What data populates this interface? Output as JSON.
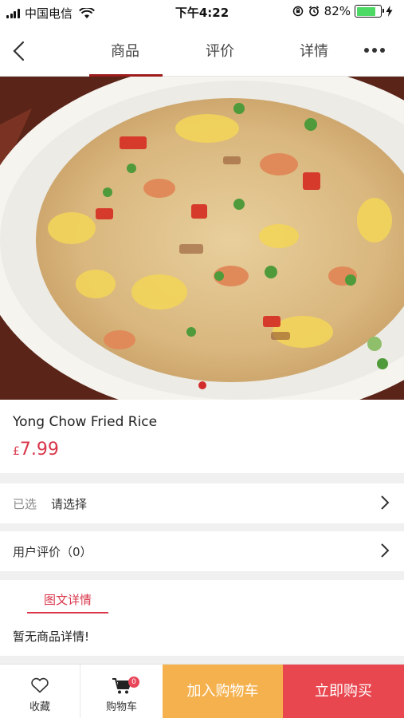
{
  "status_bar": {
    "carrier": "中国电信",
    "time": "下午4:22",
    "battery_percent": "82%",
    "battery_level": 0.82
  },
  "nav": {
    "tabs": [
      {
        "label": "商品",
        "active": true
      },
      {
        "label": "评价",
        "active": false
      },
      {
        "label": "详情",
        "active": false
      }
    ]
  },
  "gallery": {
    "image": "fried-rice-plate",
    "page_count": 1,
    "current_page": 1
  },
  "product": {
    "name": "Yong Chow Fried Rice",
    "currency": "£",
    "price": "7.99"
  },
  "selection": {
    "label": "已选",
    "value": "请选择"
  },
  "reviews": {
    "label": "用户评价（0）"
  },
  "details": {
    "tab_label": "图文详情",
    "empty_text": "暂无商品详情!"
  },
  "bottom_bar": {
    "favorite_label": "收藏",
    "cart_label": "购物车",
    "cart_badge": "0",
    "add_to_cart_label": "加入购物车",
    "buy_now_label": "立即购买"
  },
  "colors": {
    "accent_red": "#d9364a",
    "add_to_cart_bg": "#f5b14d",
    "buy_now_bg": "#e9474f",
    "tab_indicator": "#9d1c1c"
  }
}
